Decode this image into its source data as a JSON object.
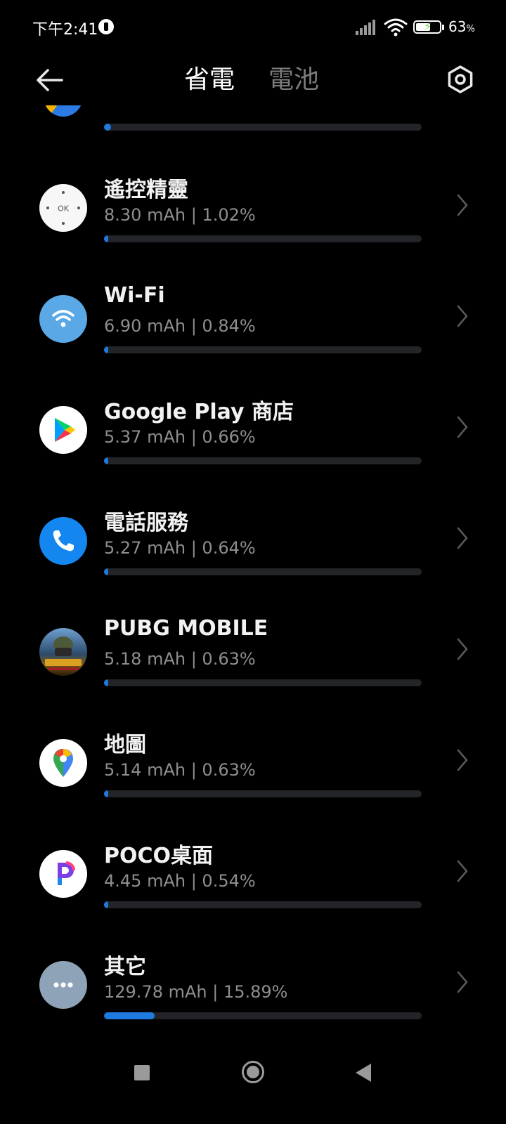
{
  "status_bar": {
    "time": "下午2:41",
    "battery_percent": "63",
    "battery_unit": "%",
    "battery_level": 0.63,
    "charging": true
  },
  "header": {
    "tabs": [
      {
        "label": "省電",
        "active": true
      },
      {
        "label": "電池",
        "active": false
      }
    ]
  },
  "apps": [
    {
      "name": "遙控精靈",
      "usage": "8.30 mAh | 1.02%",
      "percent": 1.02,
      "icon": "remote-control-icon"
    },
    {
      "name": "Wi-Fi",
      "usage": "6.90 mAh | 0.84%",
      "percent": 0.84,
      "icon": "wifi-icon"
    },
    {
      "name": "Google Play 商店",
      "usage": "5.37 mAh | 0.66%",
      "percent": 0.66,
      "icon": "google-play-icon"
    },
    {
      "name": "電話服務",
      "usage": "5.27 mAh | 0.64%",
      "percent": 0.64,
      "icon": "phone-icon"
    },
    {
      "name": "PUBG MOBILE",
      "usage": "5.18 mAh | 0.63%",
      "percent": 0.63,
      "icon": "pubg-icon"
    },
    {
      "name": "地圖",
      "usage": "5.14 mAh | 0.63%",
      "percent": 0.63,
      "icon": "maps-pin-icon"
    },
    {
      "name": "POCO桌面",
      "usage": "4.45 mAh | 0.54%",
      "percent": 0.54,
      "icon": "poco-launcher-icon"
    },
    {
      "name": "其它",
      "usage": "129.78 mAh | 15.89%",
      "percent": 15.89,
      "icon": "more-dots-icon"
    }
  ],
  "colors": {
    "background": "#000000",
    "accent": "#1f7ae0",
    "track": "#222428",
    "secondary_text": "#8e8e8e"
  }
}
